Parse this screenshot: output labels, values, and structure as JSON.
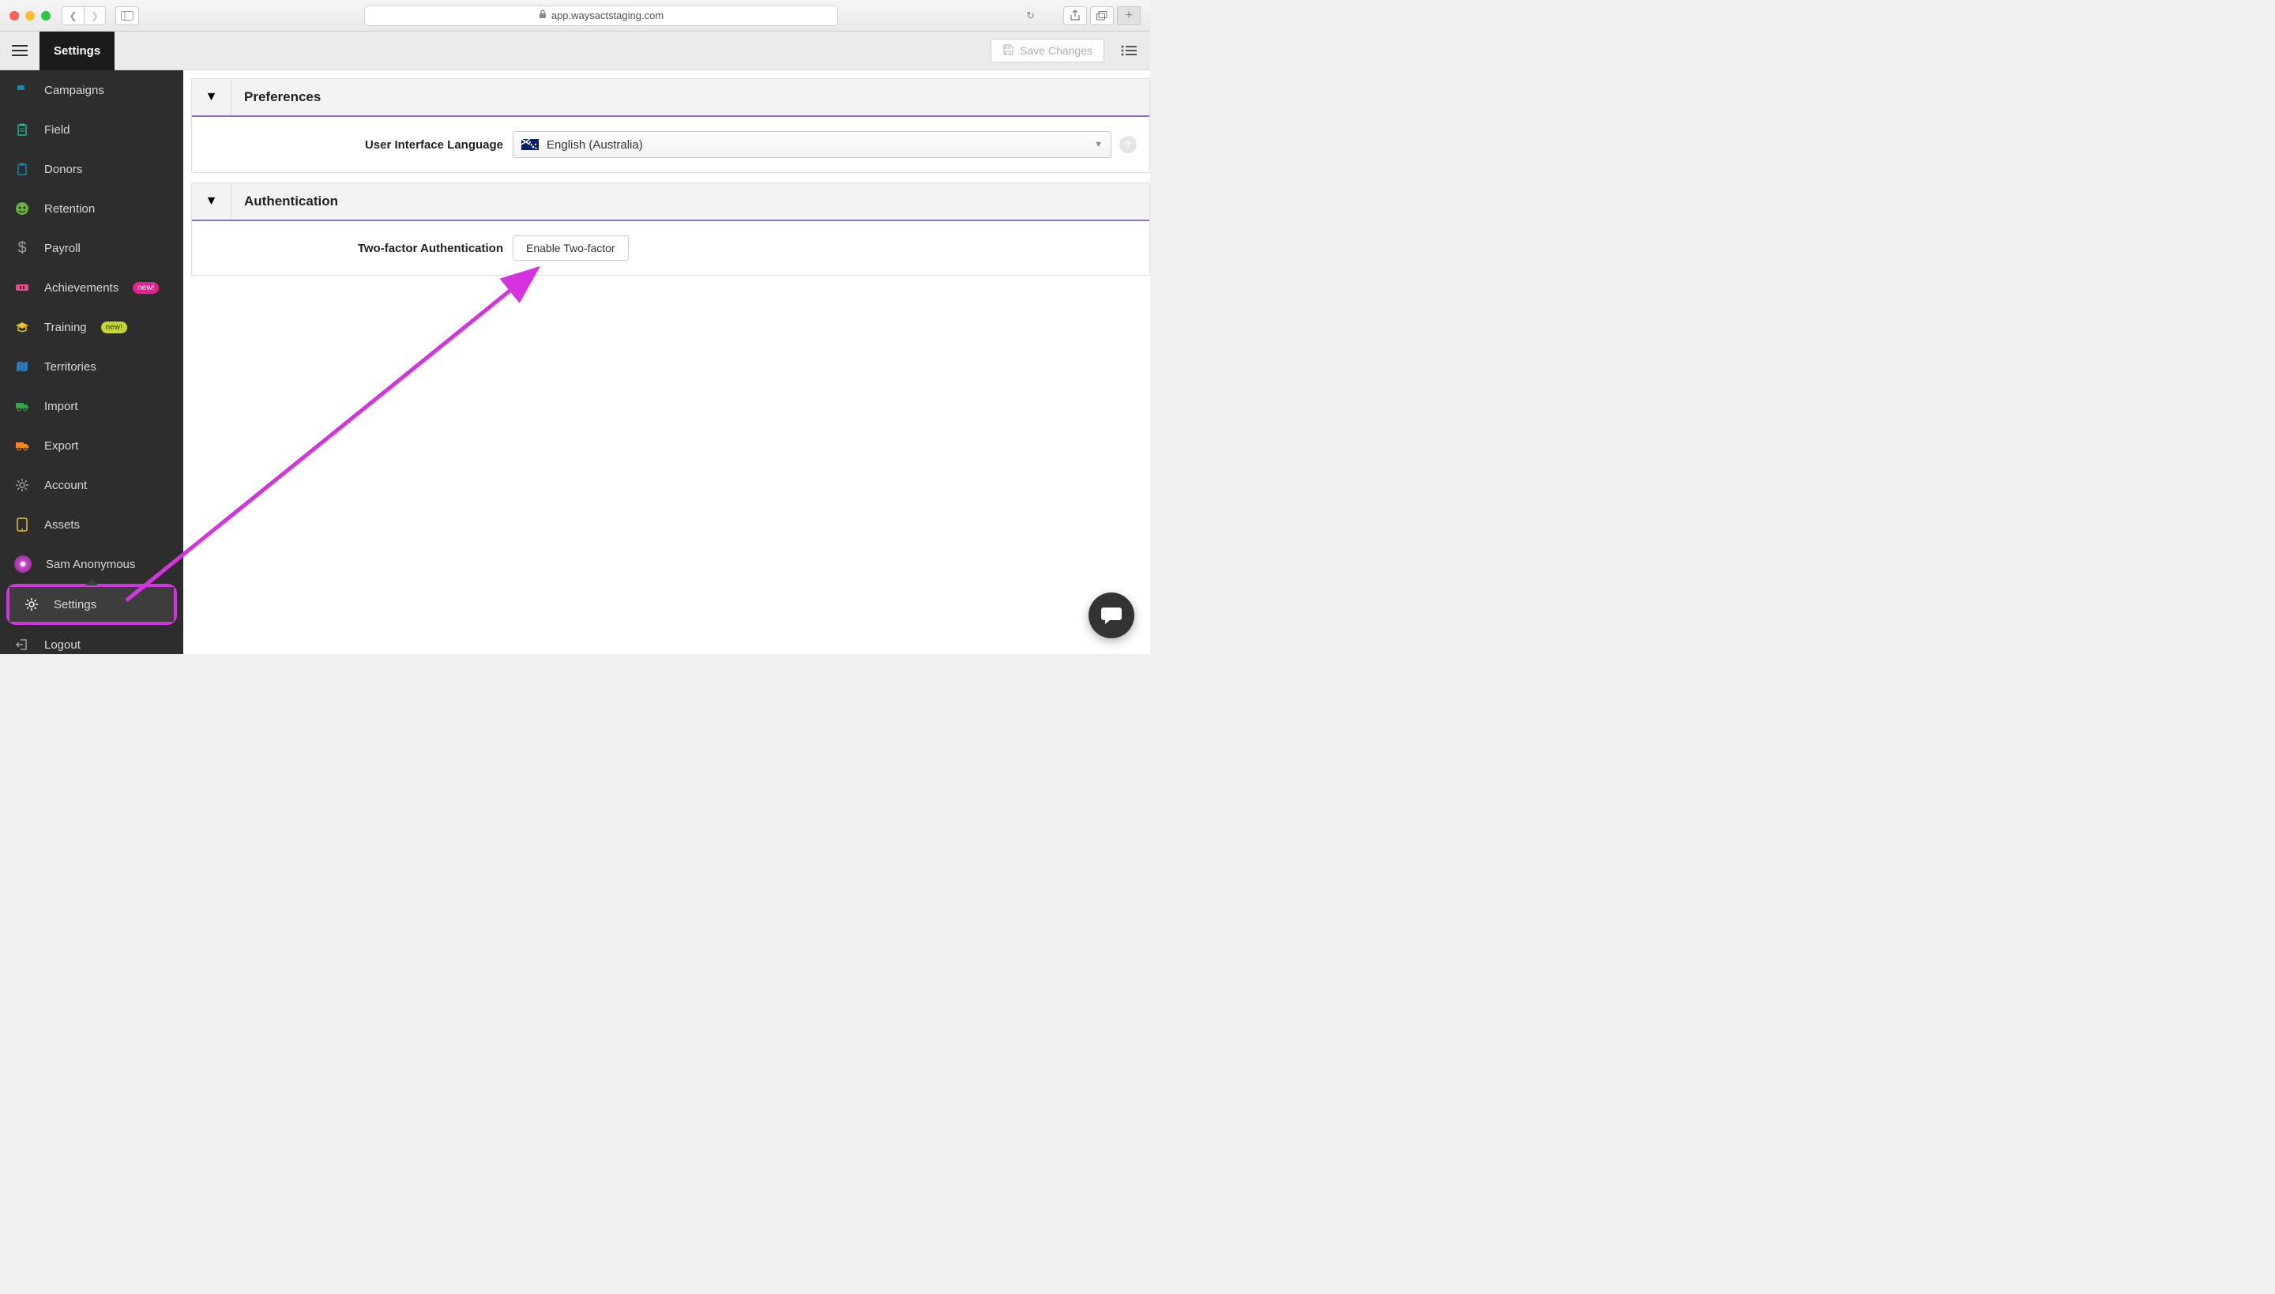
{
  "browser": {
    "url": "app.waysactstaging.com"
  },
  "topbar": {
    "tab_label": "Settings",
    "save_label": "Save Changes"
  },
  "sidebar": {
    "items": [
      {
        "label": "Campaigns",
        "icon": "flag"
      },
      {
        "label": "Field",
        "icon": "clipboard"
      },
      {
        "label": "Donors",
        "icon": "clipboard2"
      },
      {
        "label": "Retention",
        "icon": "face"
      },
      {
        "label": "Payroll",
        "icon": "dollar"
      },
      {
        "label": "Achievements",
        "icon": "badge",
        "new_badge": "new!",
        "badge_style": "pink"
      },
      {
        "label": "Training",
        "icon": "grad",
        "new_badge": "new!",
        "badge_style": "yellow"
      },
      {
        "label": "Territories",
        "icon": "map"
      },
      {
        "label": "Import",
        "icon": "truck"
      },
      {
        "label": "Export",
        "icon": "truck2"
      },
      {
        "label": "Account",
        "icon": "gear"
      },
      {
        "label": "Assets",
        "icon": "tablet"
      }
    ],
    "user": {
      "label": "Sam Anonymous"
    },
    "settings": {
      "label": "Settings"
    },
    "logout": {
      "label": "Logout"
    }
  },
  "content": {
    "preferences": {
      "title": "Preferences",
      "lang_label": "User Interface Language",
      "lang_value": "English (Australia)"
    },
    "auth": {
      "title": "Authentication",
      "twofa_label": "Two-factor Authentication",
      "twofa_button": "Enable Two-factor"
    }
  }
}
